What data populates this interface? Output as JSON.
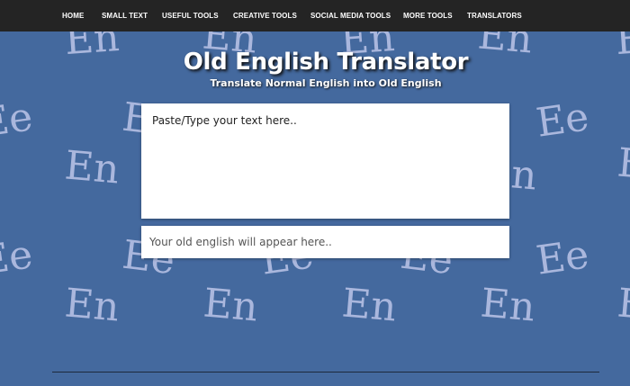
{
  "nav": {
    "items": [
      {
        "label": "HOME"
      },
      {
        "label": "SMALL TEXT"
      },
      {
        "label": "USEFUL TOOLS"
      },
      {
        "label": "CREATIVE TOOLS"
      },
      {
        "label": "SOCIAL MEDIA TOOLS"
      },
      {
        "label": "MORE TOOLS"
      },
      {
        "label": "TRANSLATORS"
      }
    ]
  },
  "header": {
    "title": "Old English Translator",
    "subtitle": "Translate Normal English into Old English"
  },
  "translator": {
    "input_placeholder": "Paste/Type your text here..",
    "output_placeholder": "Your old english will appear here.."
  },
  "background": {
    "glyph_en": "En",
    "glyph_ee": "Ee"
  },
  "colors": {
    "background": "#44699e",
    "nav_background": "#242424",
    "glyph": "#aab7dd"
  }
}
